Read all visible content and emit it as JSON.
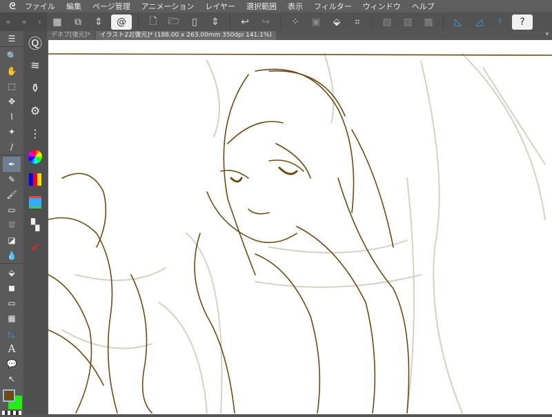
{
  "app": {
    "logo": "clip-studio-logo"
  },
  "menu": [
    "ファイル",
    "編集",
    "ページ管理",
    "アニメーション",
    "レイヤー",
    "選択範囲",
    "表示",
    "フィルター",
    "ウィンドウ",
    "ヘルプ"
  ],
  "tabs": [
    {
      "label": "デネブ[復元]*",
      "active": false
    },
    {
      "label": "イラスト22[復元]* (188.00 x 263.00mm 350dpi 141.1%)",
      "active": true
    }
  ],
  "colors": {
    "main": "#6b4b10",
    "sub": "#22ee11",
    "sketch_dark": "#6b4b10",
    "sketch_light": "#d8d0c4"
  }
}
